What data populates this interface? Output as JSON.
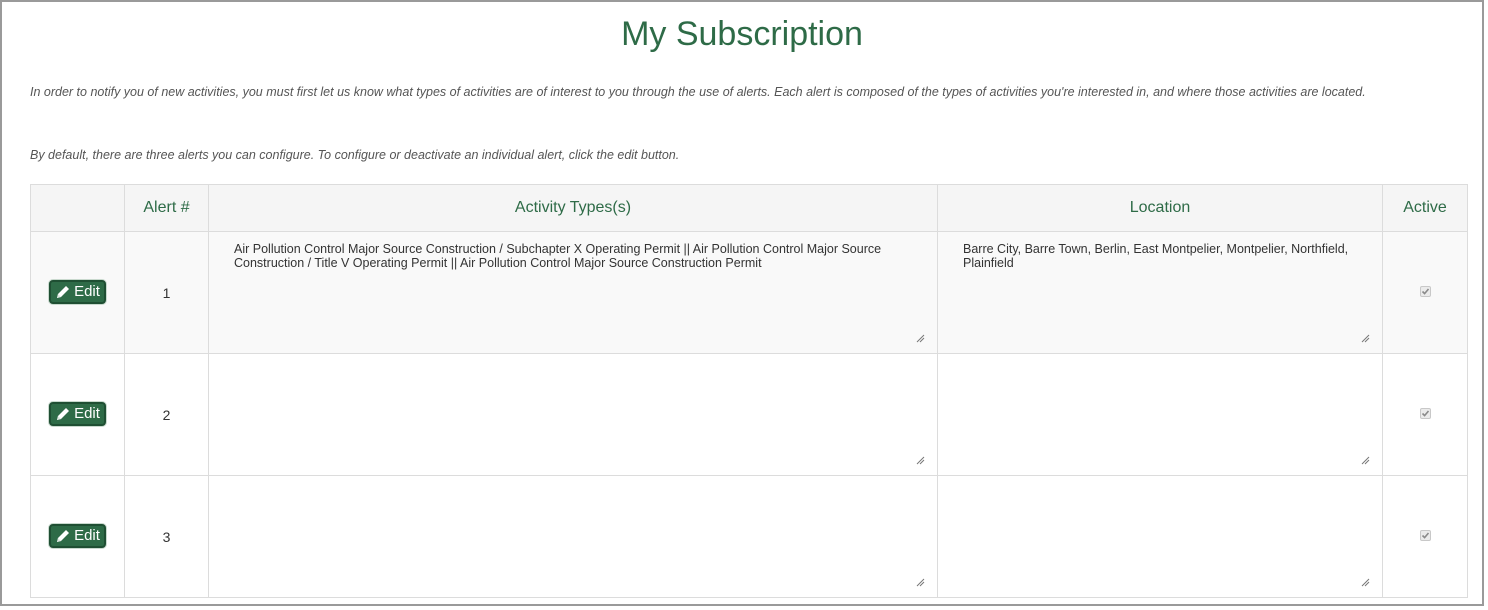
{
  "page": {
    "title": "My Subscription",
    "intro_p1": "In order to notify you of new activities, you must first let us know what types of activities are of interest to you through the use of alerts. Each alert is composed of the types of activities you're interested in, and where those activities are located.",
    "intro_p2": "By default, there are three alerts you can configure. To configure or deactivate an individual alert, click the edit button."
  },
  "table": {
    "headers": {
      "edit": "",
      "alert_num": "Alert #",
      "activity_types": "Activity Types(s)",
      "location": "Location",
      "active": "Active"
    },
    "rows": [
      {
        "edit_label": "Edit",
        "alert_num": "1",
        "activity_types": "Air Pollution Control Major Source Construction / Subchapter X Operating Permit || Air Pollution Control Major Source Construction / Title V Operating Permit || Air Pollution Control Major Source Construction Permit",
        "location": "Barre City, Barre Town, Berlin, East Montpelier, Montpelier, Northfield, Plainfield",
        "active": true
      },
      {
        "edit_label": "Edit",
        "alert_num": "2",
        "activity_types": "",
        "location": "",
        "active": true
      },
      {
        "edit_label": "Edit",
        "alert_num": "3",
        "activity_types": "",
        "location": "",
        "active": true
      }
    ]
  },
  "icons": {
    "edit": "pencil-icon",
    "resize": "resize-grip-icon",
    "check": "checkmark-icon"
  },
  "colors": {
    "brand_green": "#2e6b47",
    "header_bg": "#f5f5f5",
    "border": "#dcdcdc"
  }
}
